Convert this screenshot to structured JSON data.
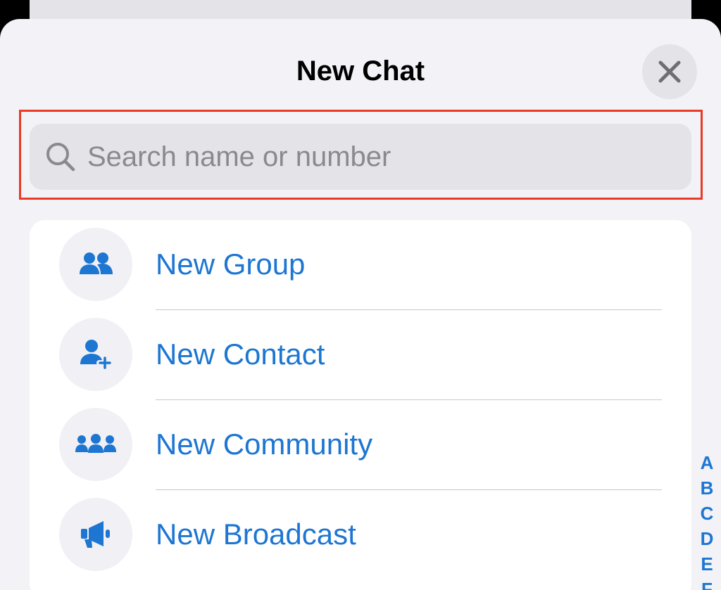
{
  "header": {
    "title": "New Chat"
  },
  "search": {
    "placeholder": "Search name or number",
    "value": ""
  },
  "actions": [
    {
      "label": "New Group",
      "icon": "group-icon"
    },
    {
      "label": "New Contact",
      "icon": "add-contact-icon"
    },
    {
      "label": "New Community",
      "icon": "community-icon"
    },
    {
      "label": "New Broadcast",
      "icon": "megaphone-icon"
    }
  ],
  "index_letters": [
    "A",
    "B",
    "C",
    "D",
    "E",
    "F"
  ],
  "colors": {
    "accent": "#1d76d2",
    "highlight": "#ea3a25",
    "background": "#f2f2f7"
  }
}
